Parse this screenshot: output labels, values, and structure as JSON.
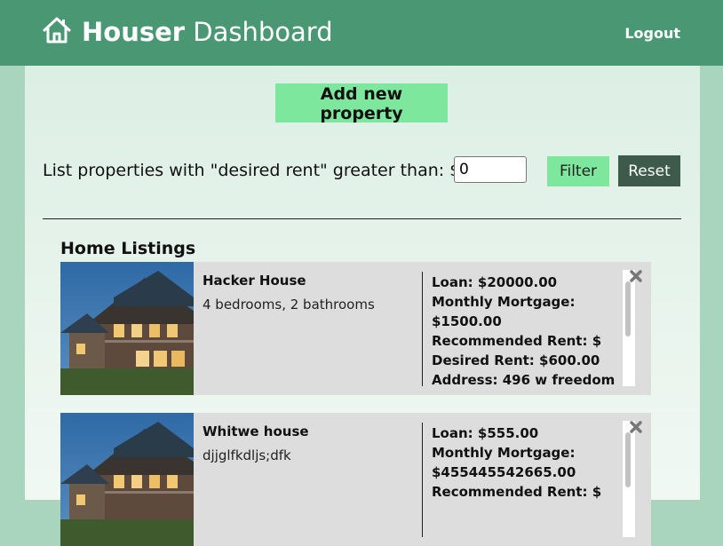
{
  "header": {
    "brand_bold": "Houser",
    "brand_rest": "Dashboard",
    "logout_label": "Logout"
  },
  "toolbar": {
    "add_label": "Add new property",
    "filter_text": "List properties with \"desired rent\" greater than: $",
    "filter_value": "0",
    "filter_label": "Filter",
    "reset_label": "Reset"
  },
  "listings": {
    "heading": "Home Listings",
    "items": [
      {
        "name": "Hacker House",
        "description": "4 bedrooms, 2 bathrooms",
        "loan": "Loan: $20000.00",
        "mortgage_label": "Monthly Mortgage:",
        "mortgage_value": "$1500.00",
        "recommended": "Recommended Rent: $",
        "desired": "Desired Rent: $600.00",
        "address": "Address: 496 w freedom"
      },
      {
        "name": "Whitwe house",
        "description": "djjglfkdljs;dfk",
        "loan": "Loan: $555.00",
        "mortgage_label": "Monthly Mortgage:",
        "mortgage_value": "$455445542665.00",
        "recommended": "Recommended Rent: $"
      }
    ]
  },
  "colors": {
    "header": "#4a9774",
    "accent_button": "#7ee79e",
    "reset_button": "#3e5a4b"
  }
}
